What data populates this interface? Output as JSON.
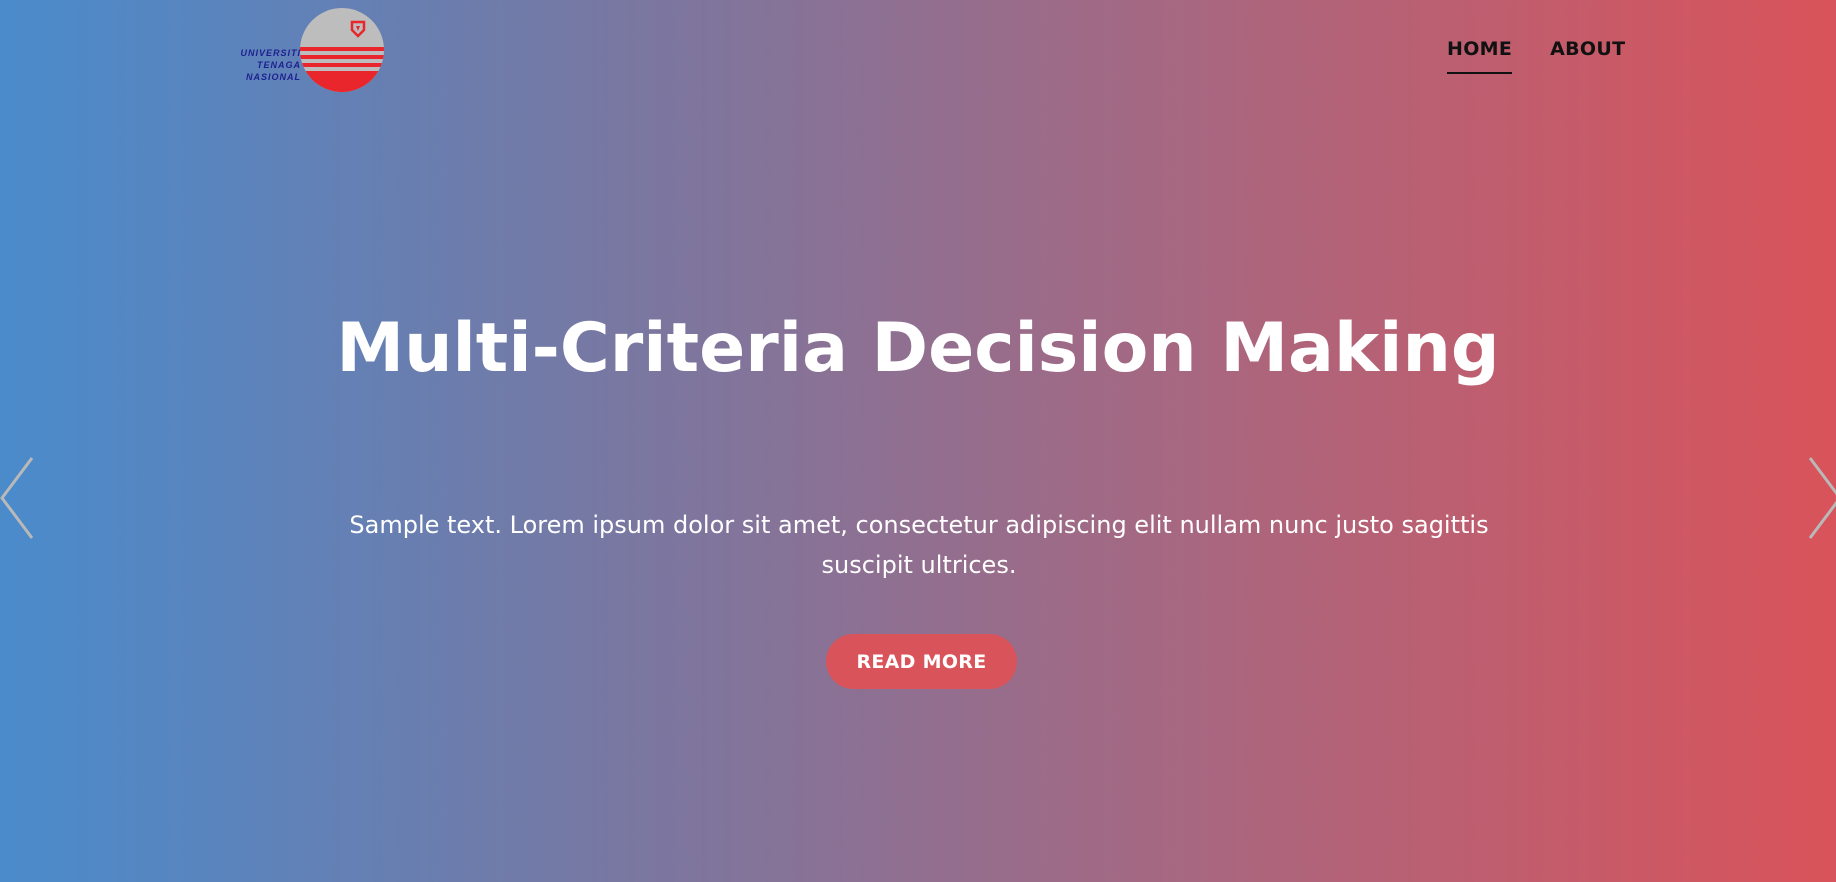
{
  "logo": {
    "name": "university-logo",
    "text_lines": [
      "UNIVERSITI",
      "TENAGA",
      "NASIONAL"
    ]
  },
  "nav": {
    "items": [
      {
        "label": "HOME",
        "active": true
      },
      {
        "label": "ABOUT",
        "active": false
      }
    ]
  },
  "hero": {
    "title": "Multi-Criteria Decision Making",
    "text": "Sample text. Lorem ipsum dolor sit amet, consectetur adipiscing elit nullam nunc justo sagittis suscipit ultrices.",
    "button_label": "READ MORE"
  },
  "carousel": {
    "prev_icon": "chevron-left-icon",
    "next_icon": "chevron-right-icon"
  },
  "colors": {
    "gradient_start": "#4a8bcc",
    "gradient_end": "#d9535a",
    "button": "#d9535a",
    "text": "#ffffff",
    "nav_text": "#111111"
  }
}
